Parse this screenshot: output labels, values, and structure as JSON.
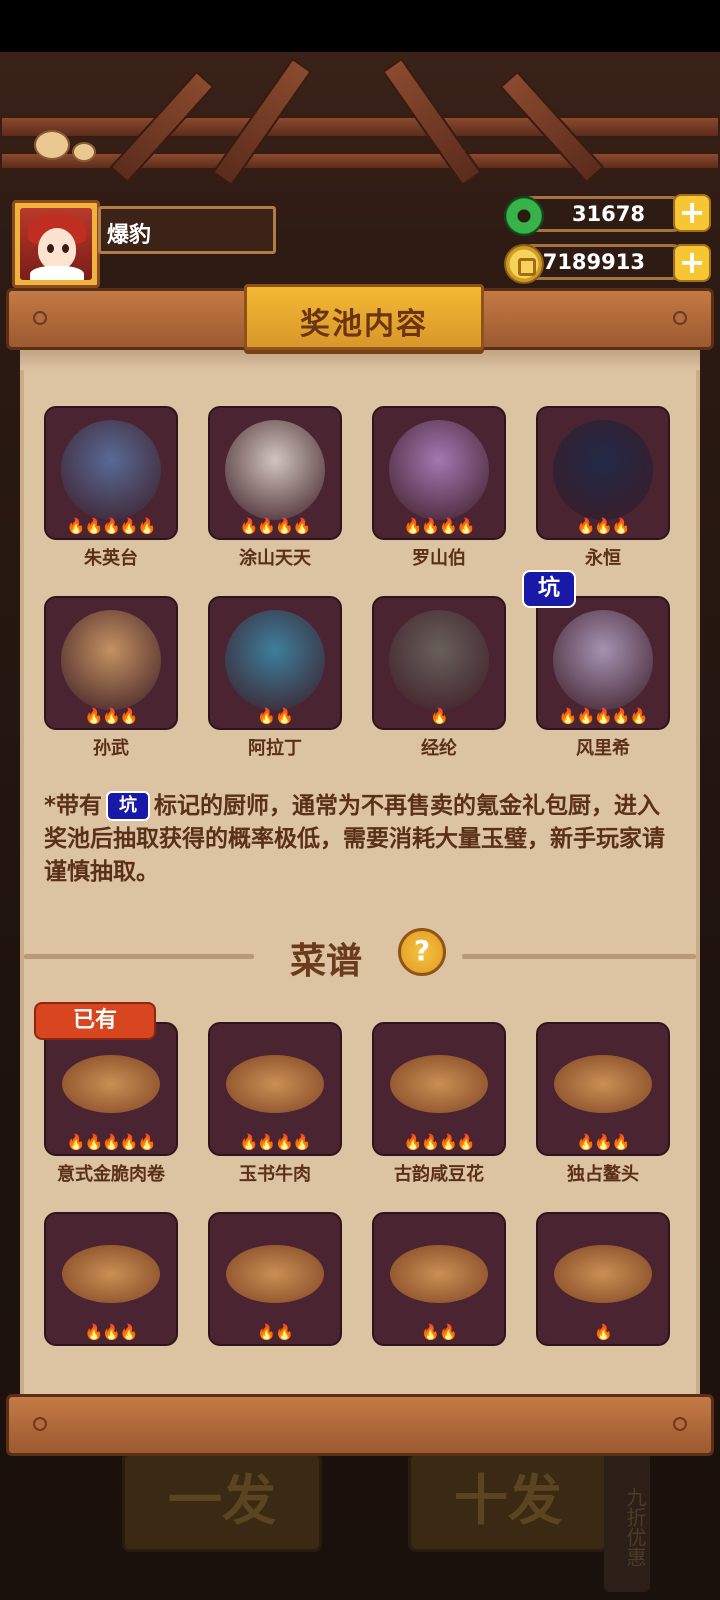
{
  "player": {
    "name": "爆豹"
  },
  "currency": {
    "jade": {
      "value": "31678",
      "icon": "jade-icon"
    },
    "coins": {
      "value": "47189913",
      "icon": "coin-icon"
    }
  },
  "panel": {
    "title": "奖池内容",
    "chefs": [
      {
        "name": "朱英台",
        "stars": 5,
        "art_color": "#5b77a8"
      },
      {
        "name": "涂山天天",
        "stars": 4,
        "art_color": "#e8e2d6"
      },
      {
        "name": "罗山伯",
        "stars": 4,
        "art_color": "#b486c9"
      },
      {
        "name": "永恒",
        "stars": 3,
        "art_color": "#1a2a4a"
      },
      {
        "name": "孙武",
        "stars": 3,
        "art_color": "#d9a56a"
      },
      {
        "name": "阿拉丁",
        "stars": 2,
        "art_color": "#3a8fb0"
      },
      {
        "name": "经纶",
        "stars": 1,
        "art_color": "#6d6a62"
      },
      {
        "name": "风里希",
        "stars": 5,
        "art_color": "#b5a6c9",
        "tag": "坑"
      }
    ],
    "note": {
      "before": "*带有",
      "tag": "坑",
      "after": "标记的厨师，通常为不再售卖的氪金礼包厨，进入奖池后抽取获得的概率极低，需要消耗大量玉璧，新手玩家请谨慎抽取。"
    },
    "recipes_title": "菜谱",
    "help_label": "?",
    "owned_label": "已有",
    "recipes": [
      {
        "name": "意式金脆肉卷",
        "stars": 5
      },
      {
        "name": "玉书牛肉",
        "stars": 4
      },
      {
        "name": "古韵咸豆花",
        "stars": 4
      },
      {
        "name": "独占鳌头",
        "stars": 3
      },
      {
        "name": "",
        "stars": 3
      },
      {
        "name": "",
        "stars": 2
      },
      {
        "name": "",
        "stars": 2
      },
      {
        "name": "",
        "stars": 1
      }
    ]
  },
  "bottom": {
    "single_draw": "一发",
    "ten_draw": "十发",
    "discount": "九折优惠"
  },
  "colors": {
    "accent": "#f3b934",
    "panel": "#dcc3a2",
    "card": "#4a2430",
    "tag": "#1919a8"
  }
}
